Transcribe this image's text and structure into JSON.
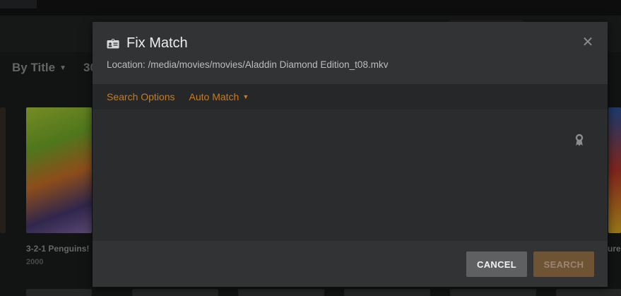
{
  "background": {
    "sort_label": "By Title",
    "count_label": "30",
    "items": [
      {
        "title": "3-2-1 Penguins!",
        "year": "2000"
      },
      {
        "title": "ure"
      }
    ]
  },
  "modal": {
    "title": "Fix Match",
    "title_icon": "id-card-icon",
    "location": "Location: /media/movies/movies/Aladdin Diamond Edition_t08.mkv",
    "close_icon": "close-icon",
    "tabs": {
      "search_options": "Search Options",
      "auto_match": "Auto Match"
    },
    "accent_color": "#cc7b19",
    "body_icon": "award-ribbon-icon",
    "buttons": {
      "cancel": "CANCEL",
      "search": "SEARCH"
    }
  }
}
